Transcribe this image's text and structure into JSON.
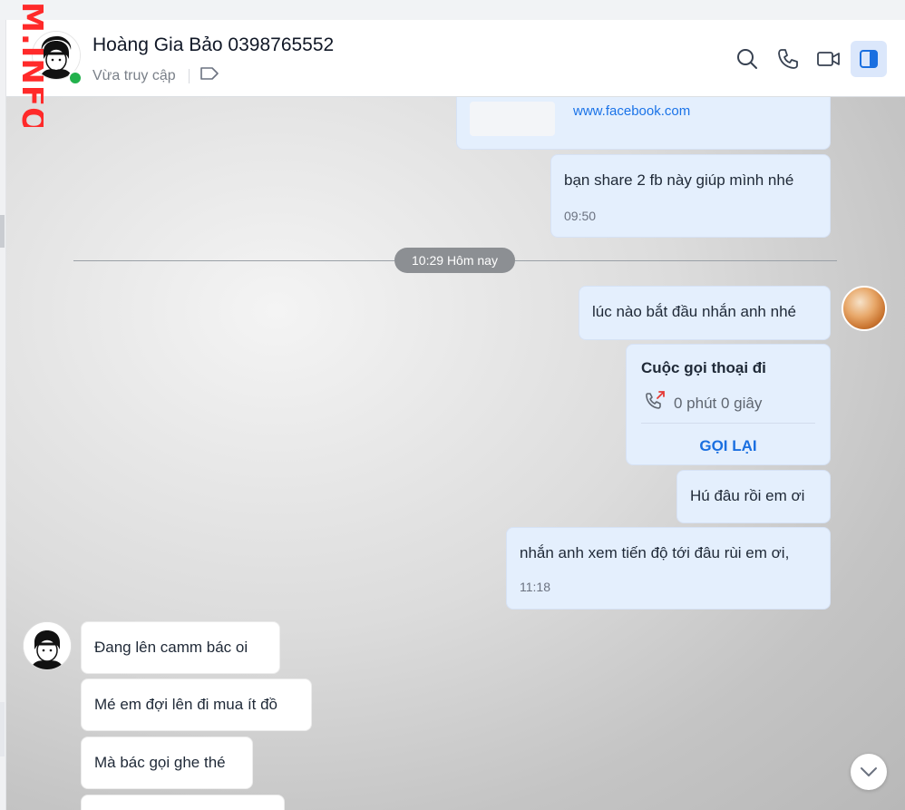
{
  "watermark": "M.INFO",
  "header": {
    "name": "Hoàng Gia Bảo 0398765552",
    "status": "Vừa truy cập"
  },
  "messages": {
    "link_url": "www.facebook.com",
    "m1_text": "bạn share 2 fb này giúp mình nhé",
    "m1_time": "09:50",
    "divider": "10:29 Hôm nay",
    "m2_text": "lúc nào bắt đầu nhắn anh nhé",
    "call_title": "Cuộc gọi thoại đi",
    "call_duration": "0 phút 0 giây",
    "call_back": "GỌI LẠI",
    "m3_text": "Hú đâu rồi em ơi",
    "m4_text": "nhắn anh xem tiến độ tới đâu rùi em ơi,",
    "m4_time": "11:18",
    "in1_text": " Đang lên camm bác oi",
    "in2_text": "Mé em đợi lên đi mua ít đồ",
    "in3_text": "Mà bác gọi ghe thé"
  },
  "colors": {
    "accent": "#1a6fe0",
    "online": "#22b14c",
    "outgoing_bubble": "#e4effd",
    "missed_call_arrow": "#e53935"
  }
}
